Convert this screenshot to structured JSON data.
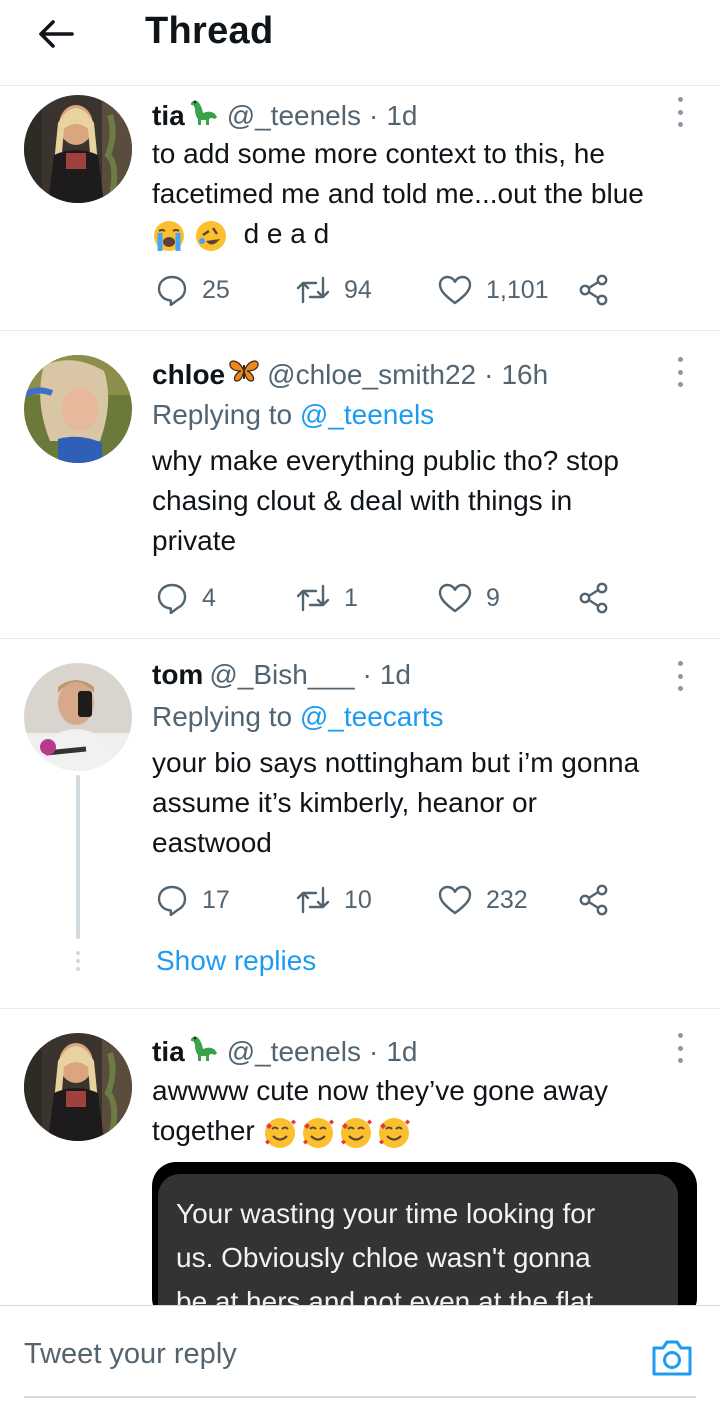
{
  "header": {
    "title": "Thread",
    "back_icon": "arrow-left-icon"
  },
  "tweets": [
    {
      "name": "tia",
      "name_emoji": "sauropod-emoji",
      "handle": "@_teenels",
      "separator": "·",
      "time": "1d",
      "body_lines": [
        "to add some more context to this, he",
        "facetimed me and told me...out the blue"
      ],
      "body_emojis": [
        "loudly-crying-face-emoji",
        "rolling-on-floor-laughing-emoji"
      ],
      "body_tail": "d e a d",
      "replies": "25",
      "retweets": "94",
      "likes": "1,101"
    },
    {
      "name": "chloe",
      "name_emoji": "butterfly-emoji",
      "handle": "@chloe_smith22",
      "separator": "·",
      "time": "16h",
      "replying_prefix": "Replying to",
      "replying_to": "@_teenels",
      "body_lines": [
        "why make everything public tho? stop",
        "chasing clout & deal with things in",
        "private"
      ],
      "replies": "4",
      "retweets": "1",
      "likes": "9"
    },
    {
      "name": "tom",
      "handle": "@_Bish___",
      "separator": "·",
      "time": "1d",
      "replying_prefix": "Replying to",
      "replying_to": "@_teecarts",
      "body_lines": [
        "your bio says nottingham but i’m gonna",
        "assume it’s kimberly, heanor or",
        "eastwood"
      ],
      "replies": "17",
      "retweets": "10",
      "likes": "232",
      "show_replies": "Show replies"
    },
    {
      "name": "tia",
      "name_emoji": "sauropod-emoji",
      "handle": "@_teenels",
      "separator": "·",
      "time": "1d",
      "body_lines": [
        "awwww cute now they’ve gone away",
        "together"
      ],
      "body_emojis": [
        "smiling-face-with-hearts-emoji",
        "smiling-face-with-hearts-emoji",
        "smiling-face-with-hearts-emoji",
        "smiling-face-with-hearts-emoji"
      ],
      "media_text_lines": [
        "Your wasting your time looking for",
        "us. Obviously chloe wasn't gonna",
        "be at hers and not even at the flat"
      ]
    }
  ],
  "reply_bar": {
    "placeholder": "Tweet your reply",
    "camera_icon": "camera-icon"
  },
  "colors": {
    "accent": "#1d9bf0",
    "secondary_text": "#536471",
    "divider": "#e6ecf0"
  }
}
